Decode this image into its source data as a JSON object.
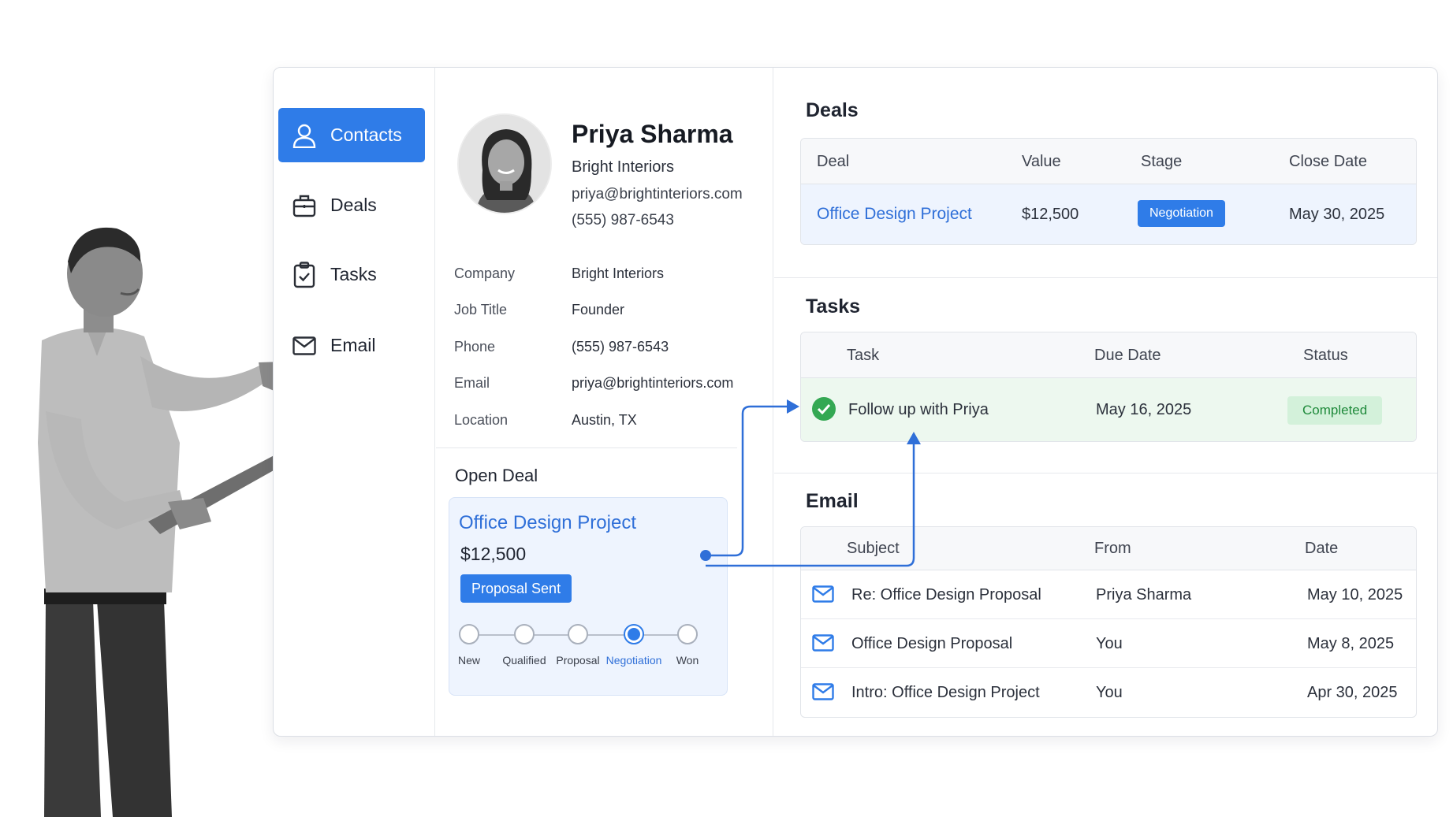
{
  "sidebar": {
    "items": [
      {
        "label": "Contacts",
        "icon": "user-icon",
        "active": true
      },
      {
        "label": "Deals",
        "icon": "briefcase-icon",
        "active": false
      },
      {
        "label": "Tasks",
        "icon": "clipboard-check-icon",
        "active": false
      },
      {
        "label": "Email",
        "icon": "mail-icon",
        "active": false
      }
    ]
  },
  "contact": {
    "name": "Priya Sharma",
    "company": "Bright Interiors",
    "email": "priya@brightinteriors.com",
    "phone": "(555) 987-6543",
    "fields": [
      {
        "label": "Company",
        "value": "Bright Interiors"
      },
      {
        "label": "Job Title",
        "value": "Founder"
      },
      {
        "label": "Phone",
        "value": "(555) 987-6543"
      },
      {
        "label": "Email",
        "value": "priya@brightinteriors.com"
      },
      {
        "label": "Location",
        "value": "Austin, TX"
      }
    ]
  },
  "open_deal": {
    "title": "Open Deal",
    "name": "Office Design Project",
    "value": "$12,500",
    "status": "Proposal Sent",
    "stages": [
      "New",
      "Qualified",
      "Proposal",
      "Negotiation",
      "Won"
    ],
    "current_stage": "Negotiation"
  },
  "deals": {
    "title": "Deals",
    "headers": [
      "Deal",
      "Value",
      "Stage",
      "Close Date"
    ],
    "rows": [
      {
        "deal": "Office Design Project",
        "value": "$12,500",
        "stage": "Negotiation",
        "close_date": "May 30, 2025"
      }
    ]
  },
  "tasks": {
    "title": "Tasks",
    "headers": [
      "Task",
      "Due Date",
      "Status"
    ],
    "rows": [
      {
        "task": "Follow up with Priya",
        "due_date": "May 16, 2025",
        "status": "Completed"
      }
    ]
  },
  "email": {
    "title": "Email",
    "headers": [
      "Subject",
      "From",
      "Date"
    ],
    "rows": [
      {
        "subject": "Re: Office Design Proposal",
        "from": "Priya Sharma",
        "date": "May 10, 2025"
      },
      {
        "subject": "Office Design Proposal",
        "from": "You",
        "date": "May 8, 2025"
      },
      {
        "subject": "Intro: Office Design Project",
        "from": "You",
        "date": "Apr 30, 2025"
      }
    ]
  },
  "colors": {
    "accent": "#2f7ce8",
    "link": "#2f6fd8",
    "success": "#34a853",
    "success_bg": "#d3f1da",
    "highlight_bg": "#eef4fe"
  }
}
